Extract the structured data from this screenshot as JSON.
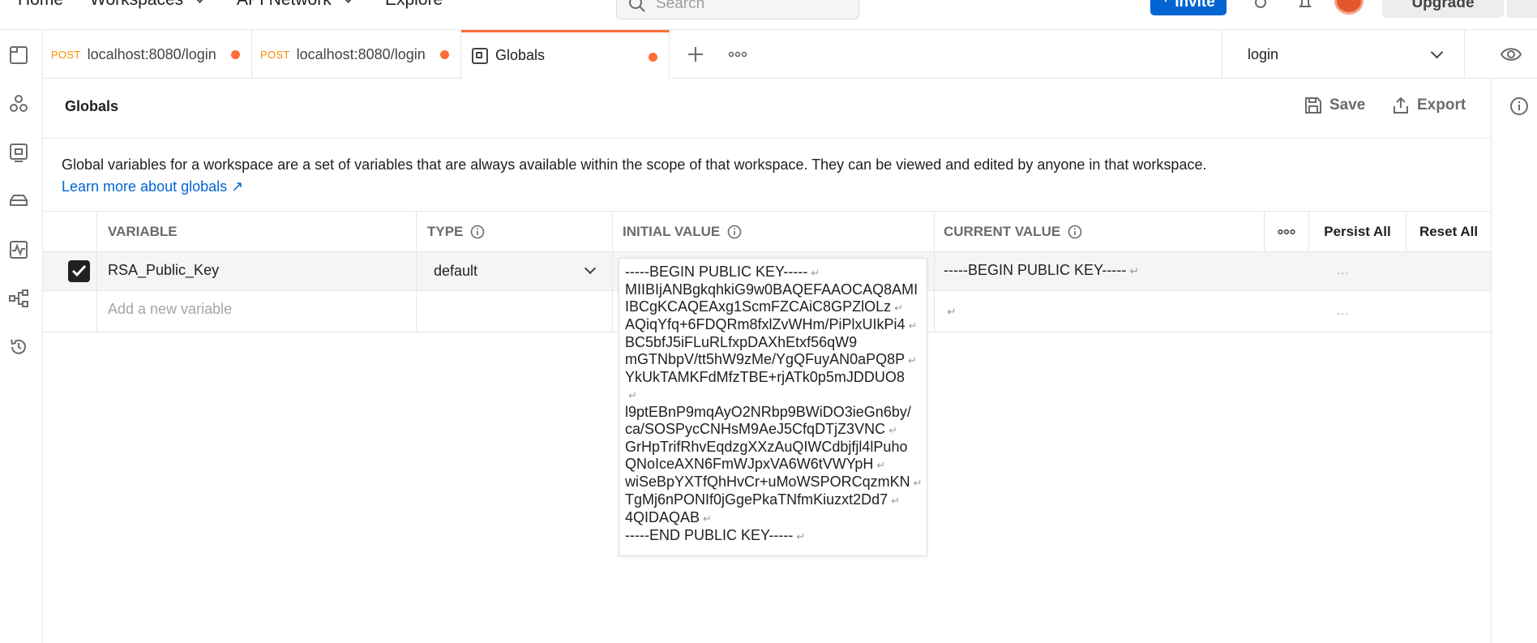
{
  "header": {
    "nav": [
      "Home",
      "Workspaces",
      "API Network",
      "Explore"
    ],
    "search_placeholder": "Search",
    "invite_label": "Invite",
    "upgrade_label": "Upgrade"
  },
  "tabs": [
    {
      "method": "POST",
      "label": "localhost:8080/login",
      "unsaved": true
    },
    {
      "method": "POST",
      "label": "localhost:8080/login",
      "unsaved": true
    },
    {
      "method": "",
      "label": "Globals",
      "unsaved": true,
      "active": true
    }
  ],
  "environment": {
    "selected": "login"
  },
  "page": {
    "title": "Globals",
    "save_label": "Save",
    "export_label": "Export",
    "description": "Global variables for a workspace are a set of variables that are always available within the scope of that workspace. They can be viewed and edited by anyone in that workspace.",
    "learn_more": "Learn more about globals ↗"
  },
  "table": {
    "headers": {
      "variable": "VARIABLE",
      "type": "TYPE",
      "initial_value": "INITIAL VALUE",
      "current_value": "CURRENT VALUE",
      "persist_all": "Persist All",
      "reset_all": "Reset All"
    },
    "rows": [
      {
        "enabled": true,
        "variable": "RSA_Public_Key",
        "type": "default",
        "current_value": "-----BEGIN PUBLIC KEY-----",
        "ellipsis": "..."
      }
    ],
    "new_row": {
      "placeholder": "Add a new variable",
      "ellipsis": "..."
    }
  },
  "initial_value_lines": [
    "-----BEGIN PUBLIC KEY-----",
    "MIIBIjANBgkqhkiG9w0BAQEFAAOCAQ8AMI",
    "IBCgKCAQEAxg1ScmFZCAiC8GPZlOLz",
    "AQiqYfq+6FDQRm8fxlZvWHm/PiPlxUIkPi4",
    "BC5bfJ5iFLuRLfxpDAXhEtxf56qW9",
    "mGTNbpV/tt5hW9zMe/YgQFuyAN0aPQ8P",
    "YkUkTAMKFdMfzTBE+rjATk0p5mJDDUO8",
    "",
    "l9ptEBnP9mqAyO2NRbp9BWiDO3ieGn6by/",
    "ca/SOSPycCNHsM9AeJ5CfqDTjZ3VNC",
    "GrHpTrifRhvEqdzgXXzAuQIWCdbjfjl4lPuho",
    "QNoIceAXN6FmWJpxVA6W6tVWYpH",
    "wiSeBpYXTfQhHvCr+uMoWSPORCqzmKN",
    "TgMj6nPONIf0jGgePkaTNfmKiuzxt2Dd7",
    "4QIDAQAB",
    "-----END PUBLIC KEY-----"
  ]
}
